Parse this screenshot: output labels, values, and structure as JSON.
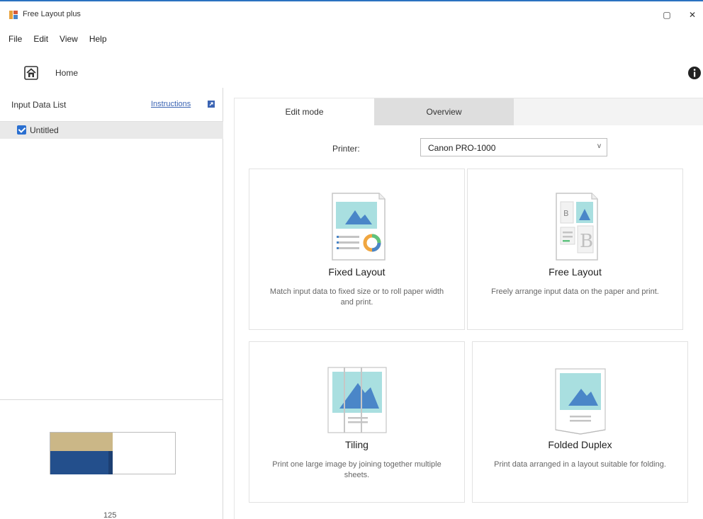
{
  "window": {
    "title": "Free Layout plus",
    "minimize_glyph": "▢",
    "close_glyph": "✕"
  },
  "menu": {
    "items": [
      "File",
      "Edit",
      "View",
      "Help"
    ]
  },
  "home": {
    "label": "Home"
  },
  "left_panel": {
    "title": "Input Data List",
    "link_label": "Instructions",
    "items": [
      {
        "label": "Untitled",
        "checked": true
      }
    ],
    "zoom_text": "125"
  },
  "tabs": [
    {
      "label": "Edit mode",
      "active": true
    },
    {
      "label": "Overview",
      "active": false
    }
  ],
  "printer": {
    "label": "Printer:",
    "value": "Canon PRO-1000",
    "chevron": "v"
  },
  "cards": [
    {
      "title": "Fixed Layout",
      "description": "Match input data to fixed size or to roll paper width and print."
    },
    {
      "title": "Free Layout",
      "description": "Freely arrange input data on the paper and print."
    },
    {
      "title": "Tiling",
      "description": "Print one large image by joining together multiple sheets."
    },
    {
      "title": "Folded Duplex",
      "description": "Print data arranged in a layout suitable for folding."
    }
  ],
  "colors": {
    "accent": "#2a6fd0",
    "titlebar_border": "#2a72c0",
    "link": "#3b64b3",
    "preview_tan": "#cbb787",
    "preview_blue": "#234f8c",
    "illus_teal": "#a9dfe0",
    "illus_blue": "#4a86c8"
  }
}
